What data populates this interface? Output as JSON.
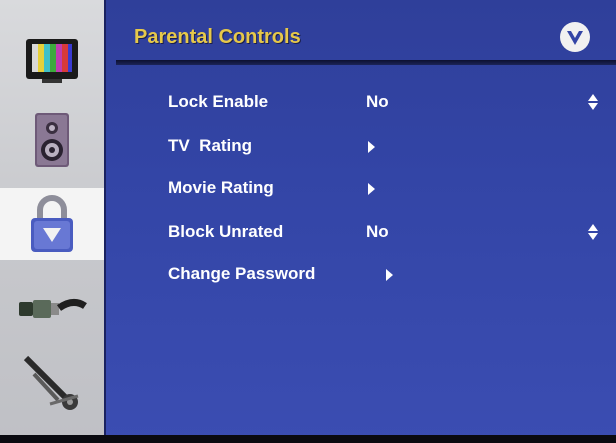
{
  "menu": {
    "title": "Parental Controls",
    "accent_color": "#e6c84a",
    "panel_color": "#3345a6",
    "brand_icon": "v-logo-icon"
  },
  "sidebar": {
    "tabs": [
      {
        "icon": "tv-picture-icon",
        "active": false
      },
      {
        "icon": "speaker-audio-icon",
        "active": false
      },
      {
        "icon": "lock-parental-icon",
        "active": true
      },
      {
        "icon": "cable-connector-icon",
        "active": false
      },
      {
        "icon": "tools-setup-icon",
        "active": false
      }
    ]
  },
  "items": [
    {
      "label": "Lock Enable",
      "value": "No",
      "control": "up-down"
    },
    {
      "label": "TV  Rating",
      "value": "",
      "control": "submenu-arrow"
    },
    {
      "label": "Movie Rating",
      "value": "",
      "control": "submenu-arrow"
    },
    {
      "label": "Block Unrated",
      "value": "No",
      "control": "up-down"
    },
    {
      "label": "Change Password",
      "value": "",
      "control": "submenu-arrow"
    }
  ]
}
